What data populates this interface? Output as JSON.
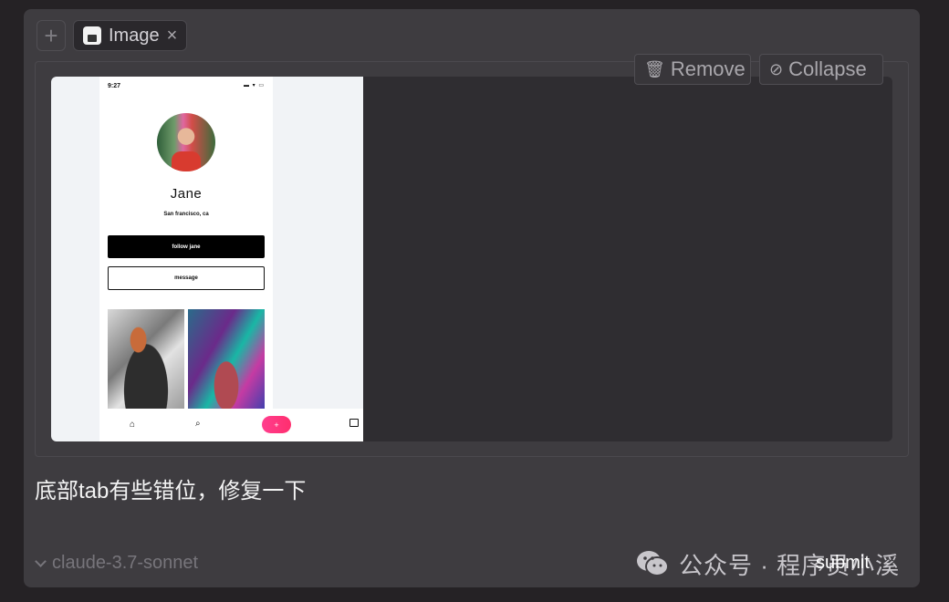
{
  "tab": {
    "add_symbol": "+",
    "label": "Image",
    "close_symbol": "×"
  },
  "toolbar": {
    "remove_label": "Remove",
    "collapse_label": "Collapse",
    "remove_icon": "trash-icon",
    "collapse_icon": "eye-off-icon"
  },
  "preview": {
    "status_time": "9:27",
    "name": "Jane",
    "location": "San francisco, ca",
    "follow_label": "follow jane",
    "message_label": "message",
    "add_symbol": "+"
  },
  "prompt": "底部tab有些错位，修复一下",
  "model": "claude-3.7-sonnet",
  "submit_label": "submit",
  "watermark": "公众号 · 程序员小溪",
  "colors": {
    "accent_pink": "#ff2e6e",
    "panel_bg": "#3e3c40",
    "page_bg": "#252225"
  }
}
